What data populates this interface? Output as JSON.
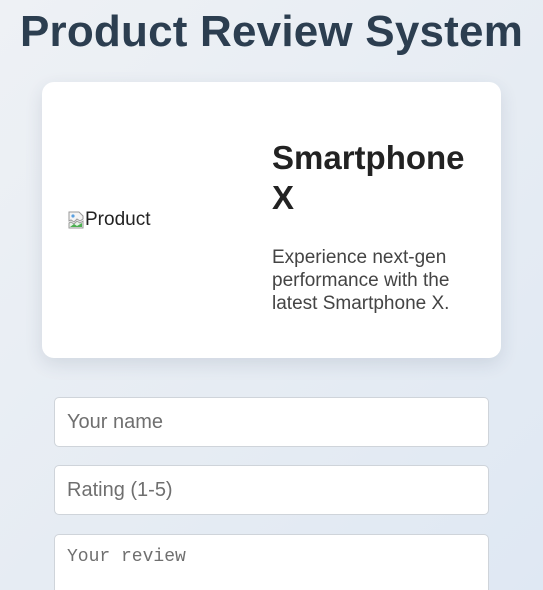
{
  "page": {
    "title": "Product Review System"
  },
  "product": {
    "image_alt": "Product",
    "name": "Smartphone X",
    "description": "Experience next-gen performance with the latest Smartphone X."
  },
  "form": {
    "name_placeholder": "Your name",
    "rating_placeholder": "Rating (1-5)",
    "review_placeholder": "Your review"
  },
  "colors": {
    "title": "#2c3e50",
    "card_background": "#ffffff",
    "page_background": "#e6ecf3"
  }
}
